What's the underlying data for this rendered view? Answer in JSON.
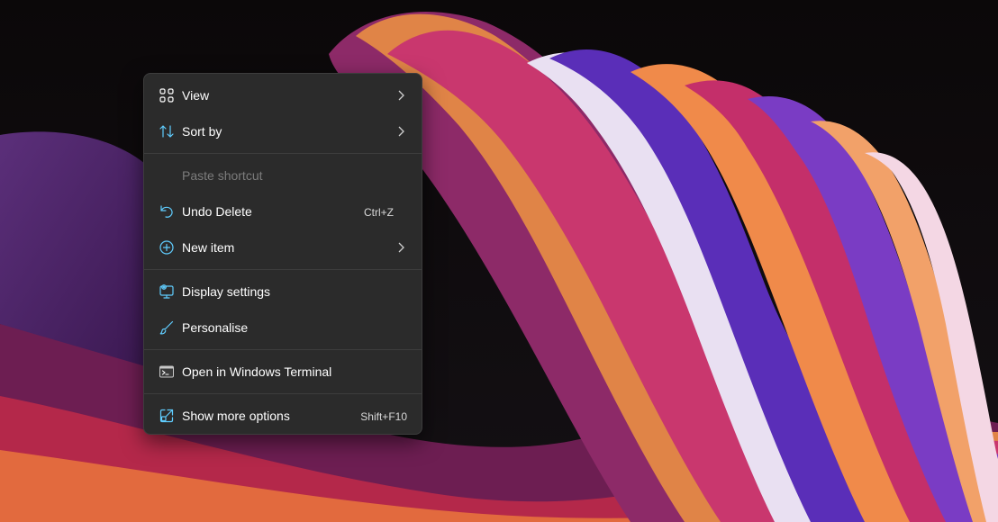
{
  "context_menu": {
    "items": [
      {
        "label": "View",
        "icon": "grid-icon",
        "submenu": true
      },
      {
        "label": "Sort by",
        "icon": "sort-icon",
        "submenu": true
      },
      {
        "label": "Paste shortcut",
        "disabled": true
      },
      {
        "label": "Undo Delete",
        "icon": "undo-icon",
        "shortcut": "Ctrl+Z"
      },
      {
        "label": "New item",
        "icon": "add-circle-icon",
        "submenu": true
      },
      {
        "label": "Display settings",
        "icon": "display-icon"
      },
      {
        "label": "Personalise",
        "icon": "brush-icon"
      },
      {
        "label": "Open in Windows Terminal",
        "icon": "terminal-icon"
      },
      {
        "label": "Show more options",
        "icon": "open-external-icon",
        "shortcut": "Shift+F10"
      }
    ]
  },
  "colors": {
    "menu_background": "#2b2b2b",
    "accent": "#60cdff",
    "text": "#ffffff",
    "disabled_text": "#7c7c7c"
  }
}
